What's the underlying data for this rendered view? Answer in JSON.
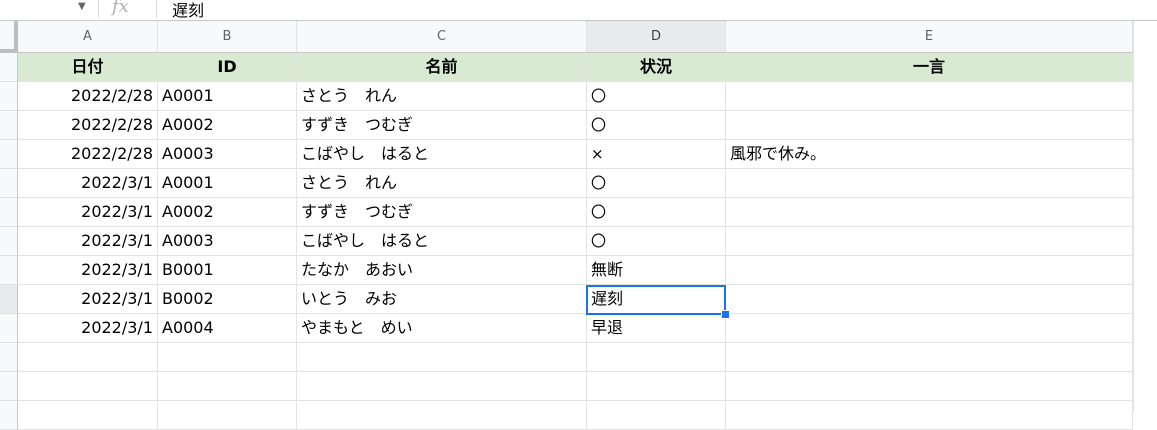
{
  "formula_bar": {
    "fx_label": "fx",
    "content": "遅刻",
    "dropdown_icon": "triangle-down-icon"
  },
  "columns": [
    "A",
    "B",
    "C",
    "D",
    "E"
  ],
  "selected_column": "D",
  "header": {
    "date": "日付",
    "id": "ID",
    "name": "名前",
    "status": "状況",
    "comment": "一言"
  },
  "rows": [
    {
      "date": "2022/2/28",
      "id": "A0001",
      "name": "さとう　れん",
      "status": "〇",
      "comment": ""
    },
    {
      "date": "2022/2/28",
      "id": "A0002",
      "name": "すずき　つむぎ",
      "status": "〇",
      "comment": ""
    },
    {
      "date": "2022/2/28",
      "id": "A0003",
      "name": "こばやし　はると",
      "status": "×",
      "comment": "風邪で休み。"
    },
    {
      "date": "2022/3/1",
      "id": "A0001",
      "name": "さとう　れん",
      "status": "〇",
      "comment": ""
    },
    {
      "date": "2022/3/1",
      "id": "A0002",
      "name": "すずき　つむぎ",
      "status": "〇",
      "comment": ""
    },
    {
      "date": "2022/3/1",
      "id": "A0003",
      "name": "こばやし　はると",
      "status": "〇",
      "comment": ""
    },
    {
      "date": "2022/3/1",
      "id": "B0001",
      "name": "たなか　あおい",
      "status": "無断",
      "comment": ""
    },
    {
      "date": "2022/3/1",
      "id": "B0002",
      "name": "いとう　みお",
      "status": "遅刻",
      "comment": ""
    },
    {
      "date": "2022/3/1",
      "id": "A0004",
      "name": "やまもと　めい",
      "status": "早退",
      "comment": ""
    }
  ],
  "active_cell": {
    "row_index": 7,
    "column": "D"
  },
  "colors": {
    "header_fill": "#d9ead3",
    "selection": "#1a73e8"
  }
}
